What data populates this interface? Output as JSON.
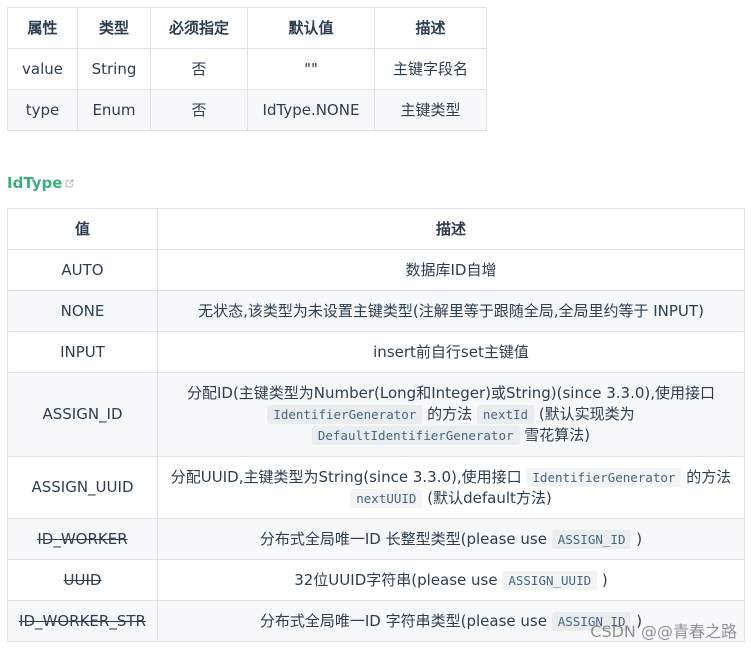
{
  "attr_table": {
    "headers": [
      "属性",
      "类型",
      "必须指定",
      "默认值",
      "描述"
    ],
    "rows": [
      [
        "value",
        "String",
        "否",
        "\"\"",
        "主键字段名"
      ],
      [
        "type",
        "Enum",
        "否",
        "IdType.NONE",
        "主键类型"
      ]
    ]
  },
  "idtype": {
    "heading": "IdType",
    "headers": [
      "值",
      "描述"
    ],
    "rows": [
      {
        "value": "AUTO",
        "desc": [
          "数据库ID自增"
        ]
      },
      {
        "value": "NONE",
        "desc": [
          "无状态,该类型为未设置主键类型(注解里等于跟随全局,全局里约等于 INPUT)"
        ]
      },
      {
        "value": "INPUT",
        "desc": [
          "insert前自行set主键值"
        ]
      },
      {
        "value": "ASSIGN_ID",
        "desc": [
          "分配ID(主键类型为Number(Long和Integer)或String)(since 3.3.0),使用接口",
          "IdentifierGenerator",
          "的方法",
          "nextId",
          "(默认实现类为",
          "DefaultIdentifierGenerator",
          "雪花算法)"
        ]
      },
      {
        "value": "ASSIGN_UUID",
        "desc": [
          "分配UUID,主键类型为String(since 3.3.0),使用接口",
          "IdentifierGenerator",
          "的方法",
          "nextUUID",
          "(默认default方法)"
        ]
      },
      {
        "value": "ID_WORKER",
        "desc": [
          "分布式全局唯一ID 长整型类型(please use",
          "ASSIGN_ID",
          ")"
        ]
      },
      {
        "value": "UUID",
        "desc": [
          "32位UUID字符串(please use",
          "ASSIGN_UUID",
          ")"
        ]
      },
      {
        "value": "ID_WORKER_STR",
        "desc": [
          "分布式全局唯一ID 字符串类型(please use",
          "ASSIGN_ID",
          ")"
        ]
      }
    ]
  },
  "watermark": "CSDN @@青春之路",
  "colors": {
    "accent": "#3eaf7c",
    "border": "#dfe2e5",
    "stripe": "#f6f8fa",
    "text": "#2c3e50"
  },
  "icons": {
    "external_link": "external-link-icon"
  }
}
